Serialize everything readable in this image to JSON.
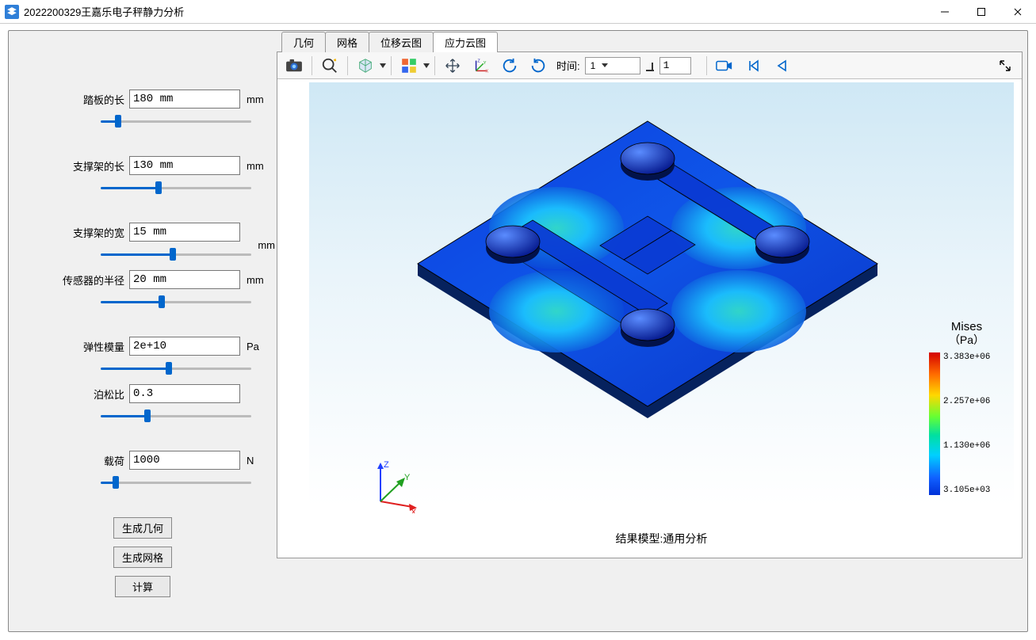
{
  "window": {
    "title": "2022200329王嘉乐电子秤静力分析"
  },
  "params": [
    {
      "label": "踏板的长",
      "value": "180 mm",
      "unit": "mm",
      "pct": 10
    },
    {
      "label": "支撑架的长",
      "value": "130 mm",
      "unit": "mm",
      "pct": 38
    },
    {
      "label": "支撑架的宽",
      "value": "15 mm",
      "unit": "mm",
      "pct": 48,
      "unitAbove": true,
      "tight": true
    },
    {
      "label": "传感器的半径",
      "value": "20 mm",
      "unit": "mm",
      "pct": 40
    },
    {
      "label": "弹性模量",
      "value": "2e+10",
      "unit": "Pa",
      "pct": 45,
      "tight": true
    },
    {
      "label": "泊松比",
      "value": "0.3",
      "unit": "",
      "pct": 30
    },
    {
      "label": "载荷",
      "value": "1000",
      "unit": "N",
      "pct": 8
    }
  ],
  "buttons": {
    "gen_geom": "生成几何",
    "gen_mesh": "生成网格",
    "compute": "计算"
  },
  "tabs": [
    "几何",
    "网格",
    "位移云图",
    "应力云图"
  ],
  "active_tab_index": 3,
  "toolbar": {
    "time_label": "时间:",
    "time_value": "1",
    "step_value": "1"
  },
  "canvas": {
    "caption": "结果模型:通用分析"
  },
  "legend": {
    "title": "Mises",
    "unit": "（Pa）",
    "ticks": [
      "3.383e+06",
      "2.257e+06",
      "1.130e+06",
      "3.105e+03"
    ]
  },
  "triad": {
    "x": "X",
    "y": "Y",
    "z": "Z"
  }
}
